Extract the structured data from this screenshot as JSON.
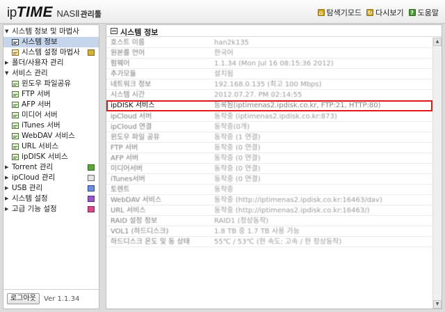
{
  "header": {
    "logo_ip": "ip",
    "logo_time": "TIME",
    "logo_nas": "NASⅡ",
    "logo_admin": "관리툴",
    "links": [
      {
        "label": "탐색기모드",
        "icon": "explorer-icon"
      },
      {
        "label": "다시보기",
        "icon": "reload-icon"
      },
      {
        "label": "도움말",
        "icon": "help-icon"
      }
    ]
  },
  "sidebar": {
    "items": [
      {
        "label": "시스템 정보 및 마법사",
        "level": 0,
        "expanded": true
      },
      {
        "label": "시스템 정보",
        "level": 1,
        "selected": true
      },
      {
        "label": "시스템 설정 마법사",
        "level": 1
      },
      {
        "label": "폴더/사용자 관리",
        "level": 0,
        "expanded": false
      },
      {
        "label": "서비스 관리",
        "level": 0,
        "expanded": true
      },
      {
        "label": "윈도우 파일공유",
        "level": 1
      },
      {
        "label": "FTP 서버",
        "level": 1
      },
      {
        "label": "AFP 서버",
        "level": 1
      },
      {
        "label": "미디어 서버",
        "level": 1
      },
      {
        "label": "iTunes 서버",
        "level": 1
      },
      {
        "label": "WebDAV 서비스",
        "level": 1
      },
      {
        "label": "URL 서비스",
        "level": 1
      },
      {
        "label": "ipDISK 서비스",
        "level": 1
      },
      {
        "label": "Torrent 관리",
        "level": 0,
        "expanded": false
      },
      {
        "label": "ipCloud 관리",
        "level": 0,
        "expanded": false
      },
      {
        "label": "USB 관리",
        "level": 0,
        "expanded": false
      },
      {
        "label": "시스템 설정",
        "level": 0,
        "expanded": false
      },
      {
        "label": "고급 기능 설정",
        "level": 0,
        "expanded": false
      }
    ],
    "logout_label": "로그아웃",
    "version": "Ver 1.1.34"
  },
  "main": {
    "title": "시스템 정보",
    "rows": [
      {
        "key": "호스트 이름",
        "value": "han2k135"
      },
      {
        "key": "원본를 언어",
        "value": "한국어"
      },
      {
        "key": "펌웨어",
        "value": "1.1.34 (Mon Jul 16 08:15:36 2012)"
      },
      {
        "key": "추가모듈",
        "value": "설치됨"
      },
      {
        "key": "네트워크 정보",
        "value": "192.168.0.135 (최고 100 Mbps)"
      },
      {
        "key": "시스템 시간",
        "value": "2012.07.27. PM 02:14:55"
      },
      {
        "key": "ipDISK 서비스",
        "value": "등록됨(iptimenas2.ipdisk.co.kr, FTP:21, HTTP:80)",
        "highlight": true
      },
      {
        "key": "ipCloud 서버",
        "value": "동작중 (iptimenas2.ipdisk.co.kr:873)"
      },
      {
        "key": "ipCloud 연결",
        "value": "동작중(0개)"
      },
      {
        "key": "윈도우 파일 공유",
        "value": "동작중 (1 연결)"
      },
      {
        "key": "FTP 서버",
        "value": "동작중 (0 연결)"
      },
      {
        "key": "AFP 서버",
        "value": "동작중 (0 연결)"
      },
      {
        "key": "미디어서버",
        "value": "동작중 (0 연결)"
      },
      {
        "key": "iTunes서버",
        "value": "동작중 (0 연결)"
      },
      {
        "key": "토렌트",
        "value": "동작중"
      },
      {
        "key": "WebDAV 서비스",
        "value": "동작중 (http://iptimenas2.ipdisk.co.kr:16463/dav)"
      },
      {
        "key": "URL 서비스",
        "value": "동작중 (http://iptimenas2.ipdisk.co.kr:16463/)"
      },
      {
        "key": "RAID 설정 정보",
        "value": "RAID1 (정상동작)"
      },
      {
        "key": "VOL1 (하드디스크)",
        "value": "1.8 TB 중 1.7 TB 사용 가능"
      },
      {
        "key": "하드디스크 온도 및 동 상태",
        "value": "55℃ / 53℃ (현 속도: 고속 / 현 정상동작)"
      }
    ]
  }
}
